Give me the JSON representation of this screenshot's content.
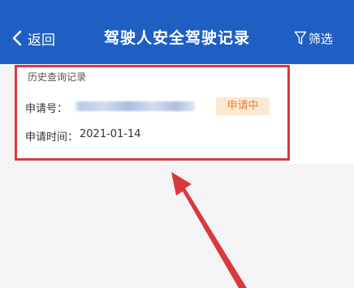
{
  "navbar": {
    "back_label": "返回",
    "title": "驾驶人安全驾驶记录",
    "filter_label": "筛选"
  },
  "record": {
    "section_title": "历史查询记录",
    "apply_no_label": "申请号：",
    "status": "申请中",
    "apply_time_label": "申请时间：",
    "apply_time_value": "2021-01-14"
  },
  "colors": {
    "navbar_bg": "#1f5fc4",
    "status_text": "#e8862a",
    "status_bg": "#fde8d2",
    "annotation_red": "#d8393d"
  },
  "icons": {
    "back": "chevron-left-icon",
    "filter": "funnel-icon",
    "annotation": "red-arrow-icon"
  }
}
